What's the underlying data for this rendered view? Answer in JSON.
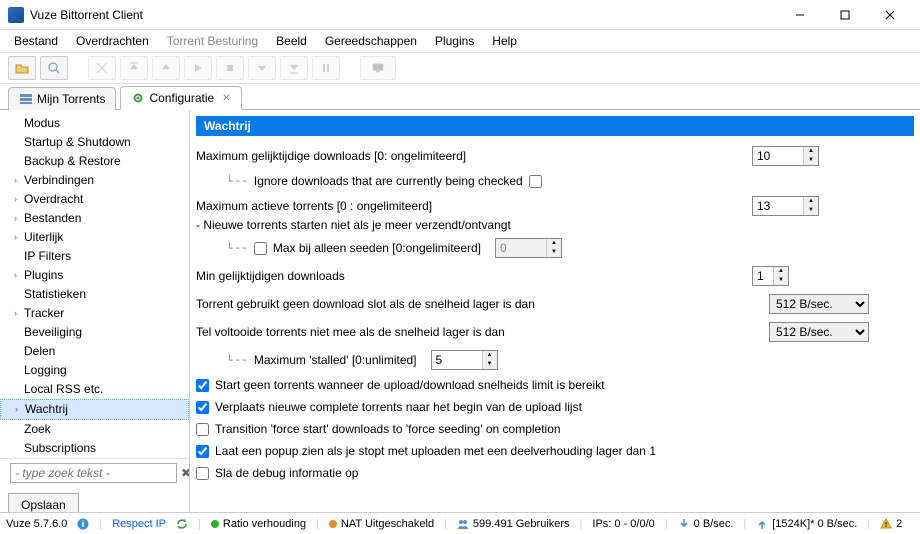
{
  "window": {
    "title": "Vuze Bittorrent Client"
  },
  "menu": {
    "items": [
      "Bestand",
      "Overdrachten",
      "Torrent Besturing",
      "Beeld",
      "Gereedschappen",
      "Plugins",
      "Help"
    ]
  },
  "tabs": {
    "torrents": "Mijn Torrents",
    "config": "Configuratie"
  },
  "tree": {
    "items": [
      {
        "label": "Modus",
        "exp": false
      },
      {
        "label": "Startup & Shutdown",
        "exp": false
      },
      {
        "label": "Backup & Restore",
        "exp": false
      },
      {
        "label": "Verbindingen",
        "exp": true
      },
      {
        "label": "Overdracht",
        "exp": true
      },
      {
        "label": "Bestanden",
        "exp": true
      },
      {
        "label": "Uiterlijk",
        "exp": true
      },
      {
        "label": "IP Filters",
        "exp": false
      },
      {
        "label": "Plugins",
        "exp": true
      },
      {
        "label": "Statistieken",
        "exp": false
      },
      {
        "label": "Tracker",
        "exp": true
      },
      {
        "label": "Beveiliging",
        "exp": false
      },
      {
        "label": "Delen",
        "exp": false
      },
      {
        "label": "Logging",
        "exp": false
      },
      {
        "label": "Local RSS etc.",
        "exp": false
      },
      {
        "label": "Wachtrij",
        "exp": true,
        "selected": true
      },
      {
        "label": "Zoek",
        "exp": false
      },
      {
        "label": "Subscriptions",
        "exp": false
      }
    ]
  },
  "search": {
    "placeholder": "- type zoek tekst -"
  },
  "save_btn": "Opslaan",
  "section": {
    "title": "Wachtrij"
  },
  "form": {
    "maxdl_label": "Maximum gelijktijdige downloads [0: ongelimiteerd]",
    "maxdl_value": "10",
    "ignore_checked": "Ignore downloads that are currently being checked",
    "maxactive_label": "Maximum actieve torrents [0 : ongelimiteerd]",
    "maxactive_note": "- Nieuwe torrents starten niet als je meer verzendt/ontvangt",
    "maxactive_value": "13",
    "maxseed_label": "Max bij alleen seeden [0:ongelimiteerd]",
    "maxseed_value": "0",
    "mindl_label": "Min gelijktijdigen downloads",
    "mindl_value": "1",
    "slotspeed_label": "Torrent gebruikt geen download slot als de snelheid lager is dan",
    "slotspeed_value": "512 B/sec.",
    "donespeed_label": "Tel voltooide torrents niet mee als de snelheid lager is dan",
    "donespeed_value": "512 B/sec.",
    "stalled_label": "Maximum 'stalled' [0:unlimited]",
    "stalled_value": "5",
    "chk_start": "Start geen torrents wanneer de upload/download snelheids limit is bereikt",
    "chk_move": "Verplaats nieuwe complete torrents naar het begin van de upload lijst",
    "chk_force": "Transition 'force start' downloads to 'force seeding' on completion",
    "chk_popup": "Laat een popup zien als je stopt met uploaden met een deelverhouding lager dan 1",
    "chk_debug": "Sla de debug informatie op"
  },
  "status": {
    "version": "Vuze 5.7.6.0",
    "respect": "Respect IP",
    "ratio": "Ratio verhouding",
    "nat": "NAT Uitgeschakeld",
    "users": "599.491 Gebruikers",
    "ips": "IPs: 0 - 0/0/0",
    "down": "0 B/sec.",
    "up": "[1524K]* 0 B/sec.",
    "warn": "2"
  }
}
